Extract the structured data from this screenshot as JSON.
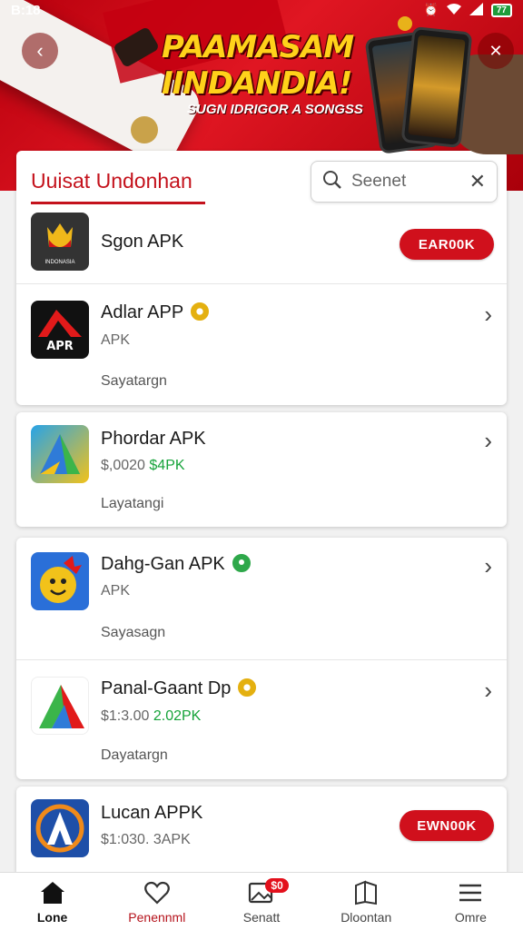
{
  "status_bar": {
    "time": "B:18",
    "battery": "77"
  },
  "banner": {
    "title_line1": "PAAMASAM",
    "title_line2": "IINDANDIA!",
    "subtitle": "SUGN IDRIGOR A SONGSS"
  },
  "search": {
    "section_title": "Uuisat Undonhan",
    "placeholder": "Seenet"
  },
  "apps": [
    {
      "name": "Sgon APK",
      "icon_text": "INDONASIA",
      "button": "EAR00K"
    },
    {
      "name": "Adlar APP",
      "sub": "APK",
      "desc": "Sayatargn",
      "badge": "gold"
    },
    {
      "name": "Phordar APK",
      "sub_price": "$,0020",
      "sub_green": "$4PK",
      "desc": "Layatangi"
    },
    {
      "name": "Dahg-Gan APK",
      "sub": "APK",
      "desc": "Sayasagn",
      "badge": "green"
    },
    {
      "name": "Panal-Gaant Dp",
      "sub_price": "$1:3.00",
      "sub_green": "2.02PK",
      "desc": "Dayatargn",
      "badge": "gold"
    },
    {
      "name": "Lucan APPK",
      "sub": "$1:030. 3APK",
      "button": "EWN00K"
    }
  ],
  "bottom_nav": [
    {
      "label": "Lone",
      "icon": "home-icon"
    },
    {
      "label": "Penennml",
      "icon": "heart-icon"
    },
    {
      "label": "Senatt",
      "icon": "image-icon",
      "badge": "$0"
    },
    {
      "label": "Dloontan",
      "icon": "book-icon"
    },
    {
      "label": "Omre",
      "icon": "menu-icon"
    }
  ],
  "colors": {
    "primary_red": "#d0101c",
    "green": "#16a33a",
    "banner_yellow": "#ffd21a"
  }
}
